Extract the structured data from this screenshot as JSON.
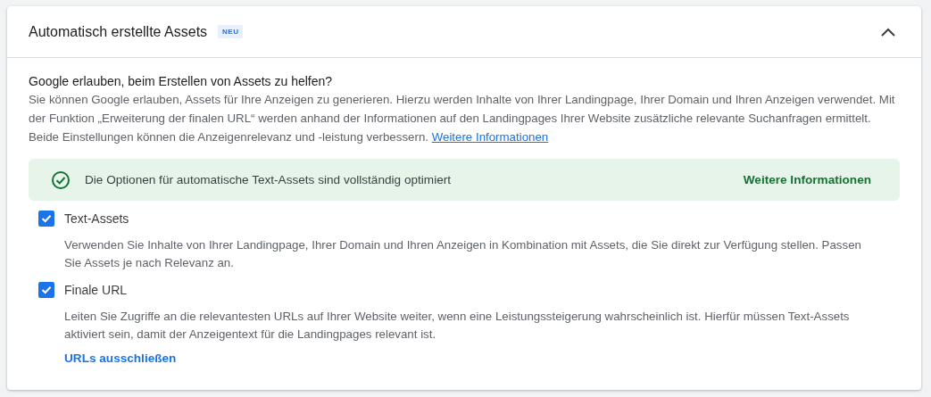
{
  "panel": {
    "title": "Automatisch erstellte Assets",
    "badge": "NEU",
    "expanded": true
  },
  "intro": {
    "heading": "Google erlauben, beim Erstellen von Assets zu helfen?",
    "text": "Sie können Google erlauben, Assets für Ihre Anzeigen zu generieren. Hierzu werden Inhalte von Ihrer Landingpage, Ihrer Domain und Ihren Anzeigen verwendet. Mit der Funktion „Erweiterung der finalen URL“ werden anhand der Informationen auf den Landingpages Ihrer Website zusätzliche relevante Suchanfragen ermittelt. Beide Einstellungen können die Anzeigenrelevanz und -leistung verbessern.",
    "link": "Weitere Informationen"
  },
  "banner": {
    "message": "Die Optionen für automatische Text-Assets sind vollständig optimiert",
    "action": "Weitere Informationen"
  },
  "options": [
    {
      "label": "Text-Assets",
      "checked": true,
      "description": "Verwenden Sie Inhalte von Ihrer Landingpage, Ihrer Domain und Ihren Anzeigen in Kombination mit Assets, die Sie direkt zur Verfügung stellen. Passen Sie Assets je nach Relevanz an."
    },
    {
      "label": "Finale URL",
      "checked": true,
      "description": "Leiten Sie Zugriffe an die relevantesten URLs auf Ihrer Website weiter, wenn eine Leistungssteigerung wahrscheinlich ist. Hierfür müssen Text-Assets aktiviert sein, damit der Anzeigentext für die Landingpages relevant ist.",
      "link": "URLs ausschließen"
    }
  ]
}
